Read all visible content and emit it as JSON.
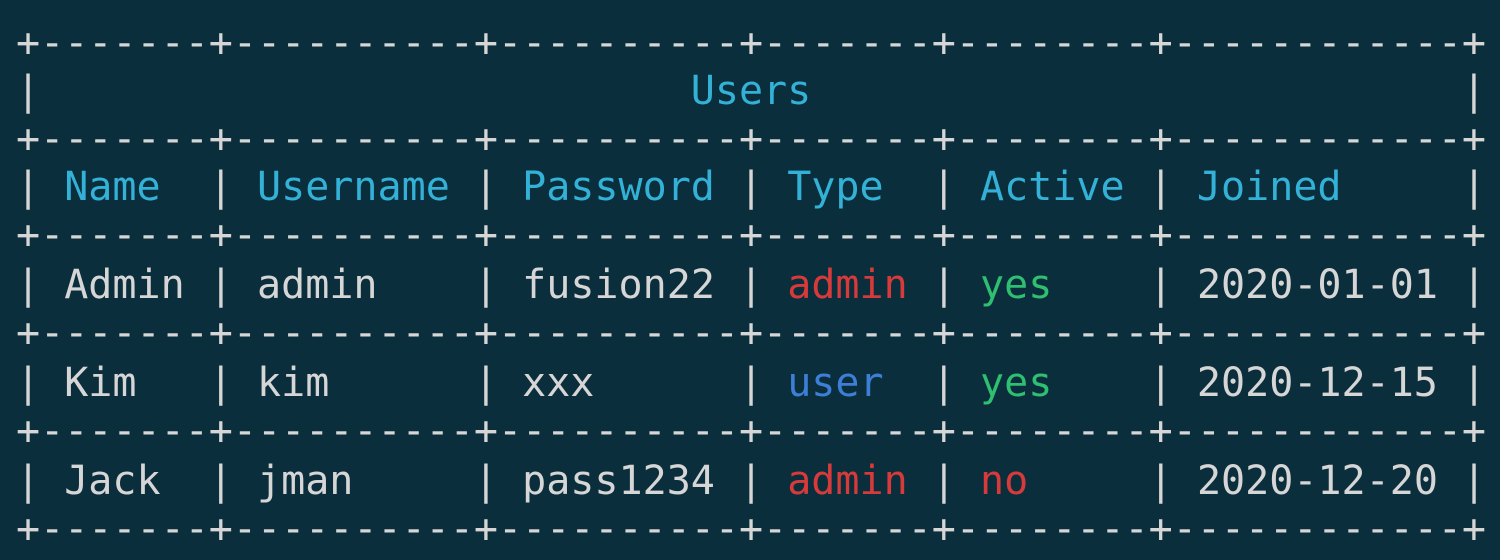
{
  "colors": {
    "background": "#0b2e3d",
    "border": "#d6d6d6",
    "text": "#d6d6d6",
    "title": "#33b1d6",
    "header": "#33b1d6",
    "admin": "#d63a3a",
    "user": "#3d7fd6",
    "yes": "#2fbf71",
    "no": "#d63a3a"
  },
  "table": {
    "title": "Users",
    "columns": [
      "Name",
      "Username",
      "Password",
      "Type",
      "Active",
      "Joined"
    ],
    "rows": [
      [
        "Admin",
        "admin",
        "fusion22",
        "admin",
        "yes",
        "2020-01-01"
      ],
      [
        "Kim",
        "kim",
        "xxx",
        "user",
        "yes",
        "2020-12-15"
      ],
      [
        "Jack",
        "jman",
        "pass1234",
        "admin",
        "no",
        "2020-12-20"
      ]
    ]
  }
}
